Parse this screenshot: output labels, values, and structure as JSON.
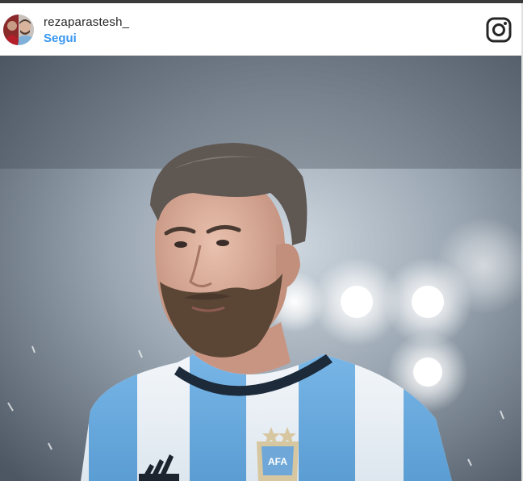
{
  "post": {
    "username": "rezaparastesh_",
    "follow_label": "Segui"
  },
  "icons": {
    "brand": "instagram-icon",
    "avatar": "profile-avatar"
  },
  "colors": {
    "follow_link": "#3897f0",
    "username_text": "#262626"
  },
  "photo": {
    "subject": "bearded man in striped football shirt",
    "crest_text": "AFA"
  }
}
